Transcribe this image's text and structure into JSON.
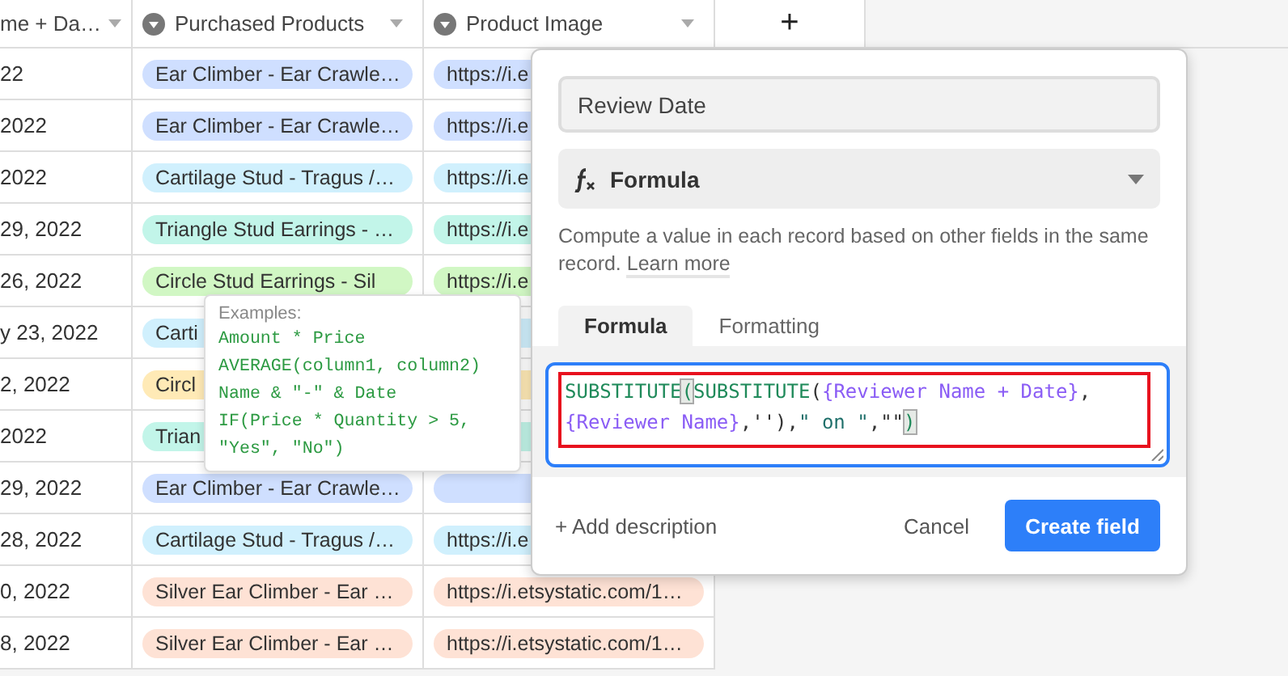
{
  "table": {
    "columns": [
      {
        "label": "me + Da…",
        "icon": false
      },
      {
        "label": "Purchased Products",
        "icon": true
      },
      {
        "label": "Product Image",
        "icon": true
      }
    ],
    "add_column": "+",
    "rows": [
      {
        "date": "22",
        "product": "Ear Climber - Ear Crawle…",
        "image": "https://i.e",
        "color": "#cfdfff"
      },
      {
        "date": "2022",
        "product": "Ear Climber - Ear Crawle…",
        "image": "https://i.e",
        "color": "#cfdfff"
      },
      {
        "date": "2022",
        "product": "Cartilage Stud - Tragus /…",
        "image": "https://i.e",
        "color": "#d0f0fd"
      },
      {
        "date": "29, 2022",
        "product": "Triangle Stud Earrings - …",
        "image": "https://i.e",
        "color": "#c2f5e9"
      },
      {
        "date": "26, 2022",
        "product": "Circle Stud Earrings - Sil",
        "image": "https://i.e",
        "color": "#d1f7c4"
      },
      {
        "date": "y 23, 2022",
        "product": "Carti",
        "color": "#d0f0fd"
      },
      {
        "date": "2, 2022",
        "product": "Circl",
        "color": "#ffeab6"
      },
      {
        "date": "2022",
        "product": "Trian",
        "color": "#c2f5e9"
      },
      {
        "date": "29, 2022",
        "product": "Ear Climber - Ear Crawle…",
        "color": "#cfdfff"
      },
      {
        "date": "28, 2022",
        "product": "Cartilage Stud - Tragus /…",
        "image": "https://i.e",
        "color": "#d0f0fd"
      },
      {
        "date": "0, 2022",
        "product": "Silver Ear Climber - Ear …",
        "image": "https://i.etsystatic.com/1…",
        "color": "#fee2d5"
      },
      {
        "date": "8, 2022",
        "product": "Silver Ear Climber - Ear …",
        "image": "https://i.etsystatic.com/1…",
        "color": "#fee2d5"
      }
    ]
  },
  "tooltip": {
    "title": "Examples:",
    "examples": [
      "Amount * Price",
      "AVERAGE(column1, column2)",
      "Name & \"-\" & Date",
      "IF(Price * Quantity > 5, \"Yes\", \"No\")"
    ]
  },
  "field_editor": {
    "name": "Review Date",
    "type": "Formula",
    "description": "Compute a value in each record based on other fields in the same record.",
    "learn_more": "Learn more",
    "tabs": [
      {
        "label": "Formula",
        "selected": true
      },
      {
        "label": "Formatting",
        "selected": false
      }
    ],
    "formula": [
      {
        "kind": "function",
        "text": "SUBSTITUTE"
      },
      {
        "kind": "match",
        "text": "("
      },
      {
        "kind": "function",
        "text": "SUBSTITUTE"
      },
      {
        "kind": "punct",
        "text": "("
      },
      {
        "kind": "field",
        "text": "{Reviewer Name + Date}"
      },
      {
        "kind": "punct",
        "text": ", "
      },
      {
        "kind": "field",
        "text": "{Reviewer Name}"
      },
      {
        "kind": "punct",
        "text": ",''),"
      },
      {
        "kind": "string",
        "text": "\" on \""
      },
      {
        "kind": "punct",
        "text": ",\"\""
      },
      {
        "kind": "match",
        "text": ")"
      }
    ],
    "highlighted": true,
    "add_description": "+ Add description",
    "cancel": "Cancel",
    "create": "Create field"
  }
}
